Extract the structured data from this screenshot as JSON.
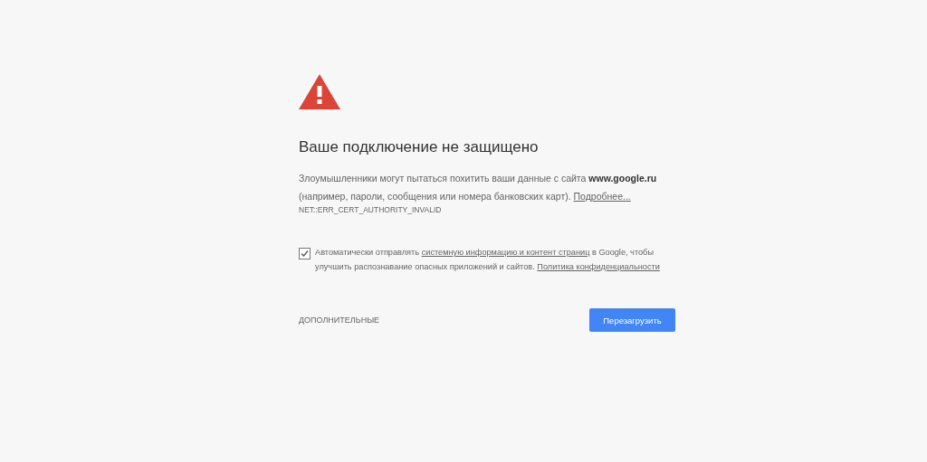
{
  "heading": "Ваше подключение не защищено",
  "explanation": [
    {
      "kind": "text",
      "text": "Злоумышленники могут пытаться похитить ваши данные с сайта "
    },
    {
      "kind": "bold",
      "text": "www.google.ru"
    },
    {
      "kind": "text",
      "text": " (например, пароли, сообщения или номера банковских карт). "
    },
    {
      "kind": "link",
      "text": "Подробнее..."
    }
  ],
  "error_code": "NET::ERR_CERT_AUTHORITY_INVALID",
  "report": {
    "checked": true,
    "parts": [
      {
        "kind": "text",
        "text": "Автоматически отправлять "
      },
      {
        "kind": "link",
        "text": "системную информацию и контент страниц"
      },
      {
        "kind": "text",
        "text": " в Google, чтобы улучшить распознавание опасных приложений и сайтов. "
      },
      {
        "kind": "link",
        "text": "Политика конфиденциальности"
      }
    ]
  },
  "advanced_button": "ДОПОЛНИТЕЛЬНЫЕ",
  "reload_button": "Перезагрузить"
}
